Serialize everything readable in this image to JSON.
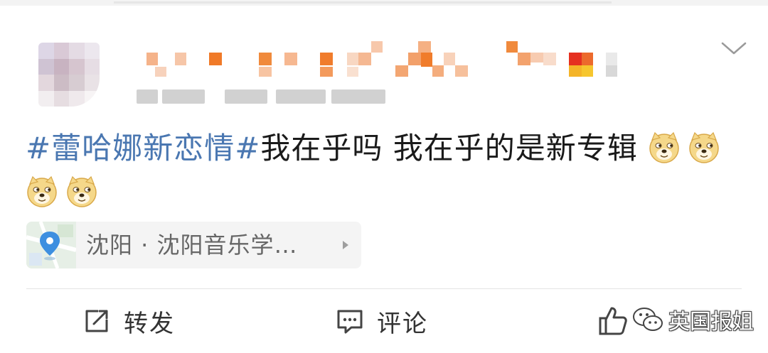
{
  "post": {
    "topic": "#蕾哈娜新恋情#",
    "text": "我在乎吗 我在乎的是新专辑",
    "emoji_name": "doge-emoji",
    "emoji_count": 4
  },
  "location": {
    "label": "沈阳 · 沈阳音乐学…",
    "icon": "location-pin-icon"
  },
  "actions": {
    "repost_label": "转发",
    "comment_label": "评论",
    "like_icon": "thumbs-up-icon"
  },
  "watermark": {
    "text": "英国报姐",
    "icon": "wechat-icon"
  },
  "colors": {
    "topic_link": "#4a77b1",
    "location_pin": "#3d8fe0",
    "text": "#1a1a1a",
    "secondary_text": "#666666"
  }
}
